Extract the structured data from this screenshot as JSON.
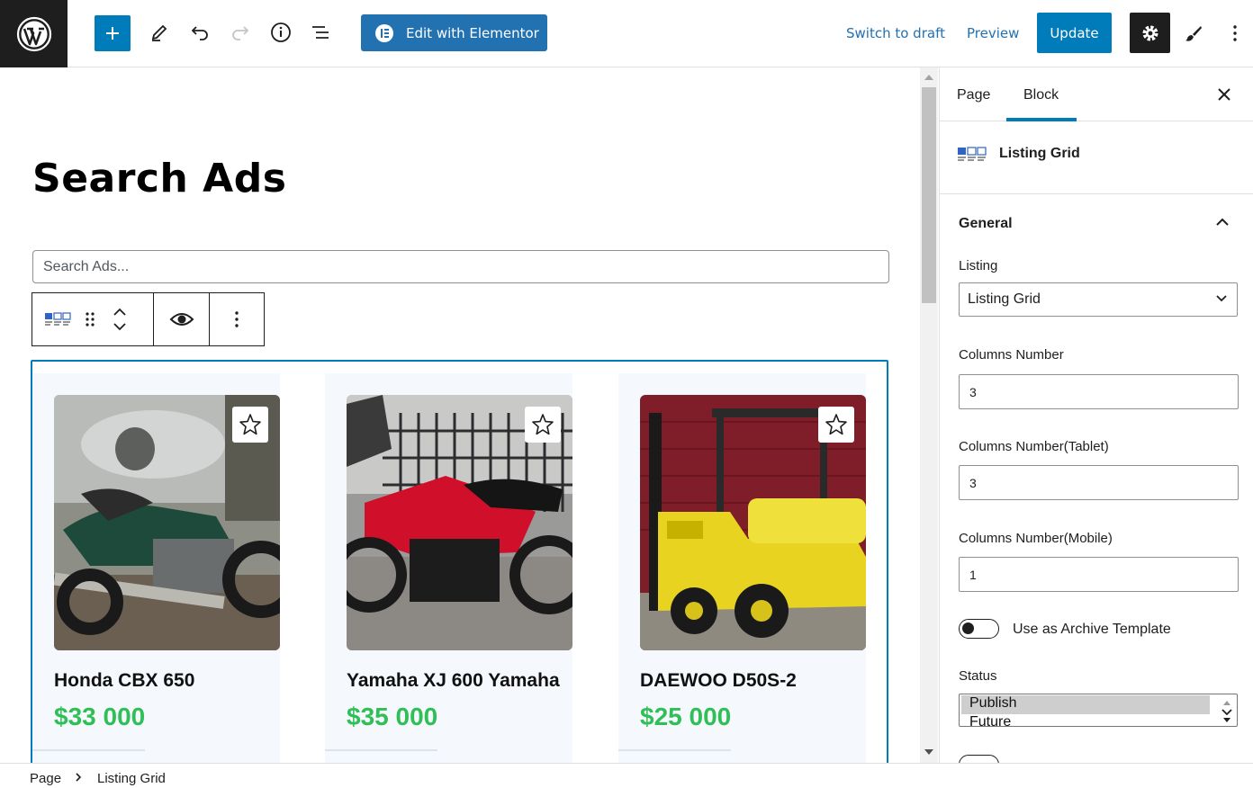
{
  "toolbar": {
    "elementor_label": "Edit with Elementor",
    "switch_draft_label": "Switch to draft",
    "preview_label": "Preview",
    "update_label": "Update"
  },
  "page": {
    "title": "Search Ads",
    "search_placeholder": "Search Ads..."
  },
  "listings": [
    {
      "title": "Honda CBX 650",
      "price": "$33 000"
    },
    {
      "title": "Yamaha XJ 600 Yamaha",
      "price": "$35 000"
    },
    {
      "title": "DAEWOO D50S-2",
      "price": "$25 000"
    }
  ],
  "sidebar": {
    "tab_page": "Page",
    "tab_block": "Block",
    "block_name": "Listing Grid",
    "panel_title": "General",
    "listing_label": "Listing",
    "listing_value": "Listing Grid",
    "columns_label": "Columns Number",
    "columns_value": "3",
    "columns_tablet_label": "Columns Number(Tablet)",
    "columns_tablet_value": "3",
    "columns_mobile_label": "Columns Number(Mobile)",
    "columns_mobile_value": "1",
    "archive_toggle_label": "Use as Archive Template",
    "status_label": "Status",
    "status_selected": "Publish",
    "status_next": "Future"
  },
  "breadcrumb": {
    "root": "Page",
    "current": "Listing Grid"
  },
  "colors": {
    "accent": "#007cba",
    "elementor": "#2271b1",
    "price": "#2fbf56",
    "dark": "#1e1e1e"
  }
}
